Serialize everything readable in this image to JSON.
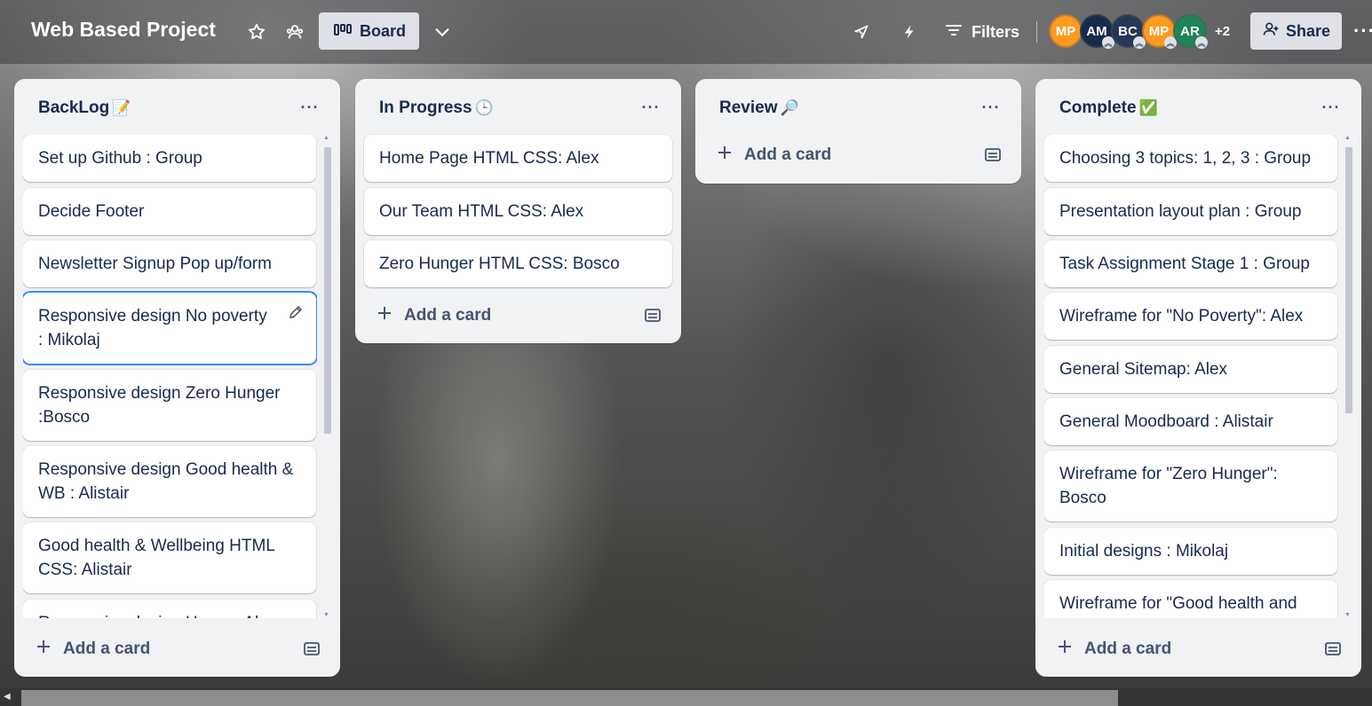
{
  "header": {
    "title": "Web Based Project",
    "star_icon": "star-icon",
    "visibility_icon": "workspace-visible-icon",
    "view_label": "Board",
    "power_up_icon": "rocket-icon",
    "automation_icon": "lightning-icon",
    "filters_label": "Filters",
    "more_members": "+2",
    "share_label": "Share",
    "overflow": "···"
  },
  "members": [
    {
      "initials": "MP",
      "color": "#ff991f",
      "admin": false
    },
    {
      "initials": "AM",
      "color": "#172b4d",
      "admin": true
    },
    {
      "initials": "BC",
      "color": "#253858",
      "admin": true
    },
    {
      "initials": "MP",
      "color": "#ff991f",
      "admin": true
    },
    {
      "initials": "AR",
      "color": "#1f845a",
      "admin": true
    }
  ],
  "lists": [
    {
      "title": "BackLog",
      "emoji": "📝",
      "add_card": "Add a card",
      "cards": [
        "Set up Github : Group",
        "Decide Footer",
        "Newsletter Signup Pop up/form",
        "Responsive design No poverty : Mikolaj",
        "Responsive design Zero Hunger :Bosco",
        "Responsive design Good health & WB : Alistair",
        "Good health & Wellbeing HTML CSS: Alistair",
        "Responsive design Human Al..."
      ]
    },
    {
      "title": "In Progress",
      "emoji": "🕒",
      "add_card": "Add a card",
      "cards": [
        "Home Page HTML CSS: Alex",
        "Our Team HTML CSS: Alex",
        "Zero Hunger HTML CSS: Bosco"
      ]
    },
    {
      "title": "Review",
      "emoji": "🔎",
      "add_card": "Add a card",
      "cards": []
    },
    {
      "title": "Complete",
      "emoji": "✅",
      "add_card": "Add a card",
      "cards": [
        "Choosing 3 topics: 1, 2, 3 : Group",
        "Presentation layout plan : Group",
        "Task Assignment Stage 1 : Group",
        "Wireframe for \"No Poverty\": Alex",
        "General Sitemap: Alex",
        "General Moodboard : Alistair",
        "Wireframe for \"Zero Hunger\": Bosco",
        "Initial designs : Mikolaj",
        "Wireframe for \"Good health and"
      ]
    }
  ],
  "colors": {
    "list_bg": "#f1f2f4",
    "card_bg": "#ffffff",
    "focus_ring": "#388bff",
    "text": "#172b4d"
  }
}
